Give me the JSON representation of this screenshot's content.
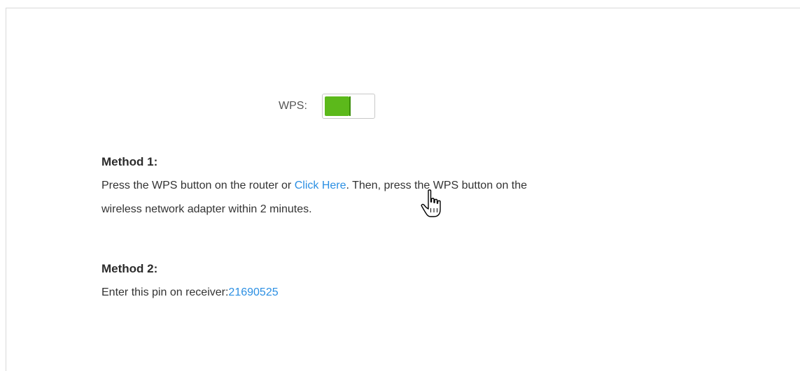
{
  "wps": {
    "label": "WPS:",
    "enabled": true,
    "accent_color": "#5cb91b"
  },
  "method1": {
    "title": "Method 1:",
    "text_before_link": "Press the WPS button on the router or ",
    "link_text": "Click Here",
    "text_after_link": ". Then, press the WPS button on the",
    "text_line2": "wireless network adapter within 2 minutes."
  },
  "method2": {
    "title": "Method 2:",
    "text": "Enter this pin on receiver:",
    "pin": "21690525"
  },
  "link_color": "#2b8fe3",
  "cursor": "hand-pointer-icon"
}
